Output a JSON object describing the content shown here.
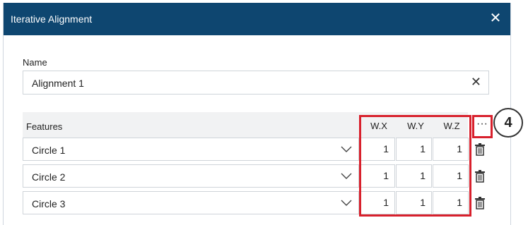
{
  "dialog": {
    "title": "Iterative Alignment",
    "close_icon": "close-icon"
  },
  "name": {
    "label": "Name",
    "value": "Alignment 1",
    "clear_icon": "close-icon"
  },
  "features": {
    "header_label": "Features",
    "columns": [
      "W.X",
      "W.Y",
      "W.Z"
    ],
    "more_label": "···",
    "rows": [
      {
        "feature": "Circle 1",
        "wx": "1",
        "wy": "1",
        "wz": "1"
      },
      {
        "feature": "Circle 2",
        "wx": "1",
        "wy": "1",
        "wz": "1"
      },
      {
        "feature": "Circle 3",
        "wx": "1",
        "wy": "1",
        "wz": "1"
      }
    ]
  },
  "annotation": {
    "callout_number": "4",
    "highlight_color": "#d8202c"
  },
  "colors": {
    "titlebar": "#0e4670",
    "header_bg": "#f1f2f3",
    "border": "#cfd4d9"
  }
}
